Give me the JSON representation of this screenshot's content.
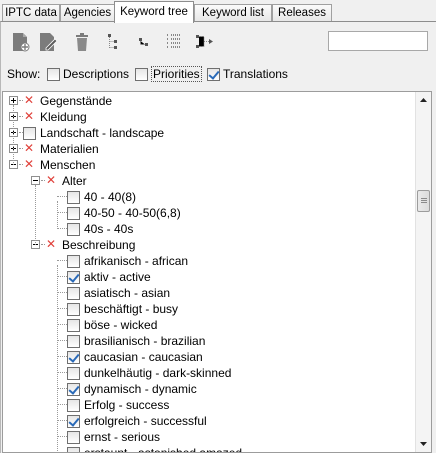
{
  "tabs": [
    {
      "label": "IPTC data"
    },
    {
      "label": "Agencies"
    },
    {
      "label": "Keyword tree",
      "active": true
    },
    {
      "label": "Keyword list"
    },
    {
      "label": "Releases"
    }
  ],
  "toolbar": {
    "icons": [
      "new-keyword-icon",
      "edit-keyword-icon",
      "delete-icon",
      "tree-structure-icon",
      "tree-small-icon",
      "list-dots-icon",
      "flow-arrow-icon"
    ],
    "search_value": ""
  },
  "show": {
    "label": "Show:",
    "options": [
      {
        "label": "Descriptions",
        "checked": false
      },
      {
        "label": "Priorities",
        "checked": false
      },
      {
        "label": "Translations",
        "checked": true
      }
    ]
  },
  "tree": {
    "rows": [
      {
        "label": "Gegenstände",
        "expander": "plus",
        "marker": "x",
        "checked": null
      },
      {
        "label": "Kleidung",
        "expander": "plus",
        "marker": "x",
        "checked": null
      },
      {
        "label": "Landschaft - landscape",
        "expander": "plus",
        "marker": "box",
        "checked": false
      },
      {
        "label": "Materialien",
        "expander": "plus",
        "marker": "x",
        "checked": null
      },
      {
        "label": "Menschen",
        "expander": "minus",
        "marker": "x",
        "checked": null
      },
      {
        "label": "Alter",
        "expander": "minus",
        "marker": "x",
        "checked": null
      },
      {
        "label": "40 - 40(8)",
        "expander": null,
        "marker": "box",
        "checked": false
      },
      {
        "label": "40-50 - 40-50(6,8)",
        "expander": null,
        "marker": "box",
        "checked": false
      },
      {
        "label": "40s - 40s",
        "expander": null,
        "marker": "box",
        "checked": false
      },
      {
        "label": "Beschreibung",
        "expander": "minus",
        "marker": "x",
        "checked": null
      },
      {
        "label": "afrikanisch - african",
        "expander": null,
        "marker": "box",
        "checked": false
      },
      {
        "label": "aktiv - active",
        "expander": null,
        "marker": "box",
        "checked": true
      },
      {
        "label": "asiatisch - asian",
        "expander": null,
        "marker": "box",
        "checked": false
      },
      {
        "label": "beschäftigt - busy",
        "expander": null,
        "marker": "box",
        "checked": false
      },
      {
        "label": "böse - wicked",
        "expander": null,
        "marker": "box",
        "checked": false
      },
      {
        "label": "brasilianisch - brazilian",
        "expander": null,
        "marker": "box",
        "checked": false
      },
      {
        "label": "caucasian - caucasian",
        "expander": null,
        "marker": "box",
        "checked": true
      },
      {
        "label": "dunkelhäutig - dark-skinned",
        "expander": null,
        "marker": "box",
        "checked": false
      },
      {
        "label": "dynamisch - dynamic",
        "expander": null,
        "marker": "box",
        "checked": true
      },
      {
        "label": "Erfolg - success",
        "expander": null,
        "marker": "box",
        "checked": false
      },
      {
        "label": "erfolgreich - successful",
        "expander": null,
        "marker": "box",
        "checked": true
      },
      {
        "label": "ernst - serious",
        "expander": null,
        "marker": "box",
        "checked": false
      },
      {
        "label": "erstaunt - astonished amazed",
        "expander": null,
        "marker": "box",
        "checked": false
      }
    ]
  },
  "colors": {
    "x_marker": "#e0403a",
    "check": "#2a6ab8"
  }
}
